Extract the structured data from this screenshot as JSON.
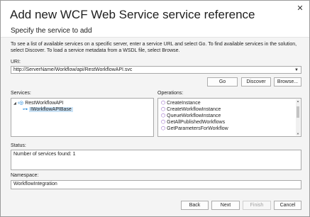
{
  "dialog": {
    "title": "Add new WCF Web Service service reference",
    "subtitle": "Specify the service to add",
    "close_glyph": "✕",
    "description": "To see a list of available services on a specific server, enter a service URL and select Go. To find available services in the solution, select Discover. To load a service metadata from a WSDL file, select Browse."
  },
  "uri": {
    "label": "URI:",
    "value": "http://ServerName/Workflow/api/RestWorkflowAPI.svc"
  },
  "buttons": {
    "go": "Go",
    "discover": "Discover",
    "browse": "Browse...",
    "back": "Back",
    "next": "Next",
    "finish": "Finish",
    "cancel": "Cancel"
  },
  "services": {
    "label": "Services:",
    "tree": [
      {
        "label": "RestWorkflowAPI",
        "expanded": true
      },
      {
        "label": "IWorkflowAPIBase",
        "selected": true
      }
    ]
  },
  "operations": {
    "label": "Operations:",
    "items": [
      "CreateInstance",
      "CreateWorkflowInstance",
      "QueueWorkflowInstance",
      "GetAllPublishedWorkflows",
      "GetParametersForWorkflow"
    ]
  },
  "status": {
    "label": "Status:",
    "text": "Number of services found: 1"
  },
  "namespace": {
    "label": "Namespace:",
    "value": "WorkflowIntegration"
  },
  "colors": {
    "accent": "#0078d7",
    "selection": "#cce4f7",
    "operation_icon": "#7a3fb8"
  }
}
